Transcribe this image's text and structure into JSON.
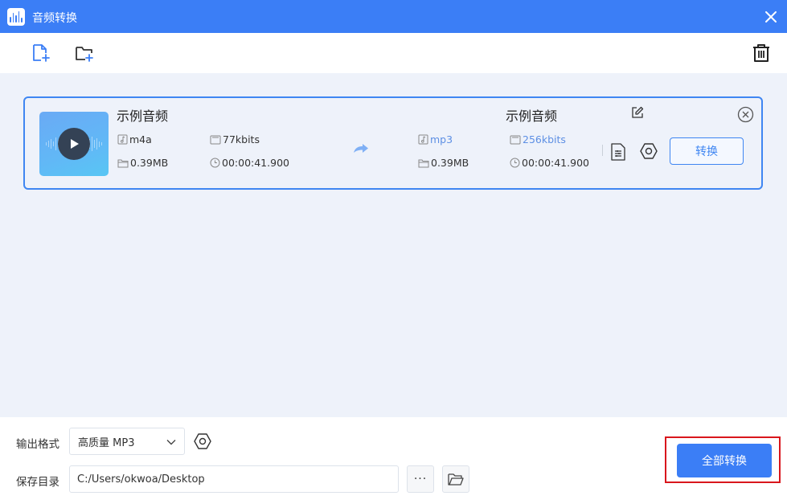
{
  "window": {
    "title": "音频转换"
  },
  "file_item": {
    "source": {
      "name": "示例音频",
      "format": "m4a",
      "bitrate": "77kbits",
      "size": "0.39MB",
      "duration": "00:00:41.900"
    },
    "target": {
      "name": "示例音频",
      "format": "mp3",
      "bitrate": "256kbits",
      "size": "0.39MB",
      "duration": "00:00:41.900"
    },
    "convert_label": "转换"
  },
  "bottom": {
    "format_label": "输出格式",
    "format_value": "高质量 MP3",
    "dir_label": "保存目录",
    "dir_value": "C:/Users/okwoa/Desktop",
    "more_label": "···",
    "convert_all_label": "全部转换"
  },
  "colors": {
    "accent": "#3b7ef6",
    "background": "#eef2fa",
    "highlight": "#d9161c"
  },
  "icons": [
    "app-logo",
    "close-icon",
    "add-file-icon",
    "add-folder-icon",
    "trash-icon",
    "play-icon",
    "music-note-icon",
    "bitrate-icon",
    "folder-icon",
    "clock-icon",
    "arrow-icon",
    "edit-icon",
    "remove-icon",
    "doc-settings-icon",
    "hex-settings-icon",
    "chevron-down-icon",
    "open-folder-icon"
  ]
}
